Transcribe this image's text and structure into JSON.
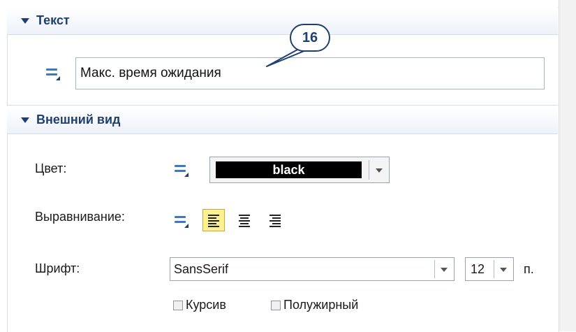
{
  "sections": {
    "text": {
      "title": "Текст",
      "value": "Макс. время ожидания"
    },
    "appearance": {
      "title": "Внешний вид",
      "color_label": "Цвет:",
      "color_value": "black",
      "align_label": "Выравнивание:",
      "font_label": "Шрифт:",
      "font_value": "SansSerif",
      "font_size": "12",
      "size_unit": "п.",
      "italic_label": "Курсив",
      "bold_label": "Полужирный"
    }
  },
  "callout": {
    "number": "16"
  },
  "colors": {
    "accent": "#1f3f6e",
    "icon_blue": "#3d78c5",
    "selected_button": "#fbf190"
  },
  "icons": [
    "collapse-triangle-icon",
    "dynamic-value-icon",
    "align-left-icon",
    "align-center-icon",
    "align-right-icon",
    "dropdown-arrow-icon"
  ]
}
